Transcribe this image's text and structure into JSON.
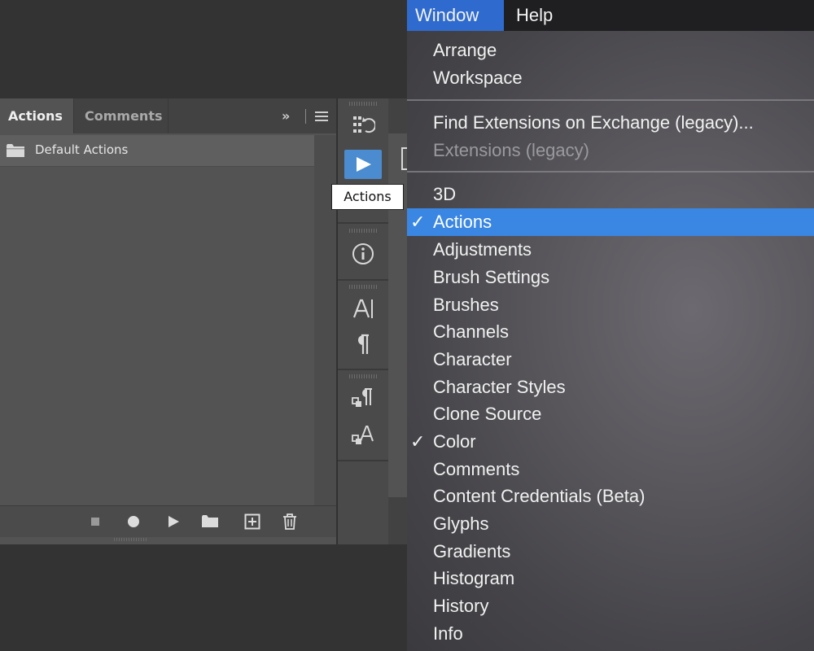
{
  "actions_panel": {
    "tabs": [
      {
        "label": "Actions",
        "active": true
      },
      {
        "label": "Comments",
        "active": false
      }
    ],
    "collapse_glyph": "»",
    "items": [
      {
        "label": "Default Actions",
        "icon": "folder-icon"
      }
    ],
    "footer_buttons": [
      "stop-icon",
      "record-icon",
      "play-icon",
      "new-set-folder-icon",
      "new-action-icon",
      "trash-icon"
    ]
  },
  "icon_strip": {
    "icons": [
      "history-icon",
      "play-icon",
      "info-icon",
      "character-icon",
      "paragraph-icon",
      "paragraph-styles-icon",
      "character-styles-icon"
    ],
    "tooltip": "Actions"
  },
  "menubar": {
    "items": [
      "Window",
      "Help"
    ],
    "active": "Window"
  },
  "window_menu": {
    "group1": [
      "Arrange",
      "Workspace"
    ],
    "group2": [
      {
        "label": "Find Extensions on Exchange (legacy)...",
        "disabled": false
      },
      {
        "label": "Extensions (legacy)",
        "disabled": true
      }
    ],
    "group3": [
      {
        "label": "3D",
        "checked": false
      },
      {
        "label": "Actions",
        "checked": true,
        "highlighted": true
      },
      {
        "label": "Adjustments",
        "checked": false
      },
      {
        "label": "Brush Settings",
        "checked": false
      },
      {
        "label": "Brushes",
        "checked": false
      },
      {
        "label": "Channels",
        "checked": false
      },
      {
        "label": "Character",
        "checked": false
      },
      {
        "label": "Character Styles",
        "checked": false
      },
      {
        "label": "Clone Source",
        "checked": false
      },
      {
        "label": "Color",
        "checked": true
      },
      {
        "label": "Comments",
        "checked": false
      },
      {
        "label": "Content Credentials (Beta)",
        "checked": false
      },
      {
        "label": "Glyphs",
        "checked": false
      },
      {
        "label": "Gradients",
        "checked": false
      },
      {
        "label": "Histogram",
        "checked": false
      },
      {
        "label": "History",
        "checked": false
      },
      {
        "label": "Info",
        "checked": false
      }
    ],
    "check_glyph": "✓"
  },
  "colors": {
    "menu_highlight": "#3a86e3",
    "menubar_active": "#2f6bce",
    "play_button": "#4b8bcf"
  }
}
